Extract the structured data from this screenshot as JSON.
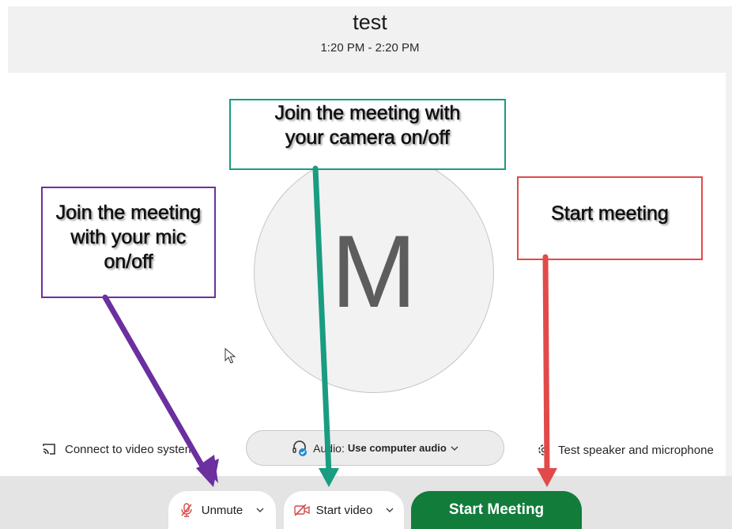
{
  "meeting": {
    "title": "test",
    "time_range": "1:20 PM - 2:20 PM"
  },
  "preview": {
    "avatar_initial": "M"
  },
  "device_bar": {
    "connect_label": "Connect to video system",
    "connect_icon": "cast-icon",
    "audio_prefix": "Audio:",
    "audio_value": "Use computer audio",
    "audio_icon": "headset-icon",
    "test_label": "Test speaker and microphone",
    "test_icon": "gear-icon"
  },
  "controls": {
    "unmute_label": "Unmute",
    "unmute_icon": "muted-mic-icon",
    "video_label": "Start video",
    "video_icon": "video-off-icon",
    "start_label": "Start Meeting"
  },
  "annotations": {
    "camera": [
      "Join the meeting with",
      "your camera on/off"
    ],
    "mic": [
      "Join the meeting",
      "with your mic",
      "on/off"
    ],
    "start": [
      "Start meeting"
    ]
  },
  "colors": {
    "start_button": "#127c3b",
    "mic_annotation": "#6b2fa0",
    "camera_annotation": "#1a9c80",
    "start_annotation": "#e24a4a",
    "muted_icon": "#d64a4a"
  }
}
